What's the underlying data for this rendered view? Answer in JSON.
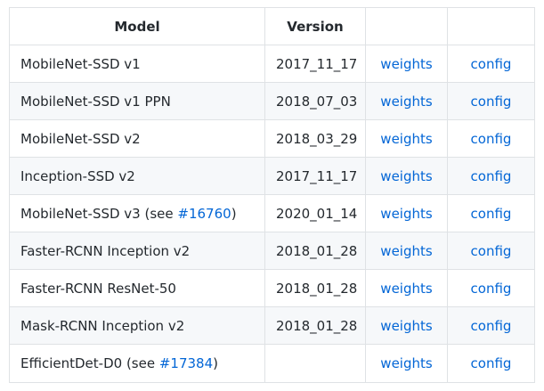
{
  "table": {
    "headers": {
      "model": "Model",
      "version": "Version",
      "weights": "",
      "config": ""
    },
    "rows": [
      {
        "model": "MobileNet-SSD v1",
        "see_prefix": "",
        "see_link": "",
        "see_suffix": "",
        "version": "2017_11_17",
        "weights": "weights",
        "config": "config"
      },
      {
        "model": "MobileNet-SSD v1 PPN",
        "see_prefix": "",
        "see_link": "",
        "see_suffix": "",
        "version": "2018_07_03",
        "weights": "weights",
        "config": "config"
      },
      {
        "model": "MobileNet-SSD v2",
        "see_prefix": "",
        "see_link": "",
        "see_suffix": "",
        "version": "2018_03_29",
        "weights": "weights",
        "config": "config"
      },
      {
        "model": "Inception-SSD v2",
        "see_prefix": "",
        "see_link": "",
        "see_suffix": "",
        "version": "2017_11_17",
        "weights": "weights",
        "config": "config"
      },
      {
        "model": "MobileNet-SSD v3",
        "see_prefix": " (see ",
        "see_link": "#16760",
        "see_suffix": ")",
        "version": "2020_01_14",
        "weights": "weights",
        "config": "config"
      },
      {
        "model": "Faster-RCNN Inception v2",
        "see_prefix": "",
        "see_link": "",
        "see_suffix": "",
        "version": "2018_01_28",
        "weights": "weights",
        "config": "config"
      },
      {
        "model": "Faster-RCNN ResNet-50",
        "see_prefix": "",
        "see_link": "",
        "see_suffix": "",
        "version": "2018_01_28",
        "weights": "weights",
        "config": "config"
      },
      {
        "model": "Mask-RCNN Inception v2",
        "see_prefix": "",
        "see_link": "",
        "see_suffix": "",
        "version": "2018_01_28",
        "weights": "weights",
        "config": "config"
      },
      {
        "model": "EfficientDet-D0",
        "see_prefix": " (see ",
        "see_link": "#17384",
        "see_suffix": ")",
        "version": "",
        "weights": "weights",
        "config": "config"
      }
    ]
  },
  "colors": {
    "link": "#0366d6",
    "text": "#24292e",
    "border": "#dfe2e5",
    "stripe": "#f6f8fa"
  }
}
